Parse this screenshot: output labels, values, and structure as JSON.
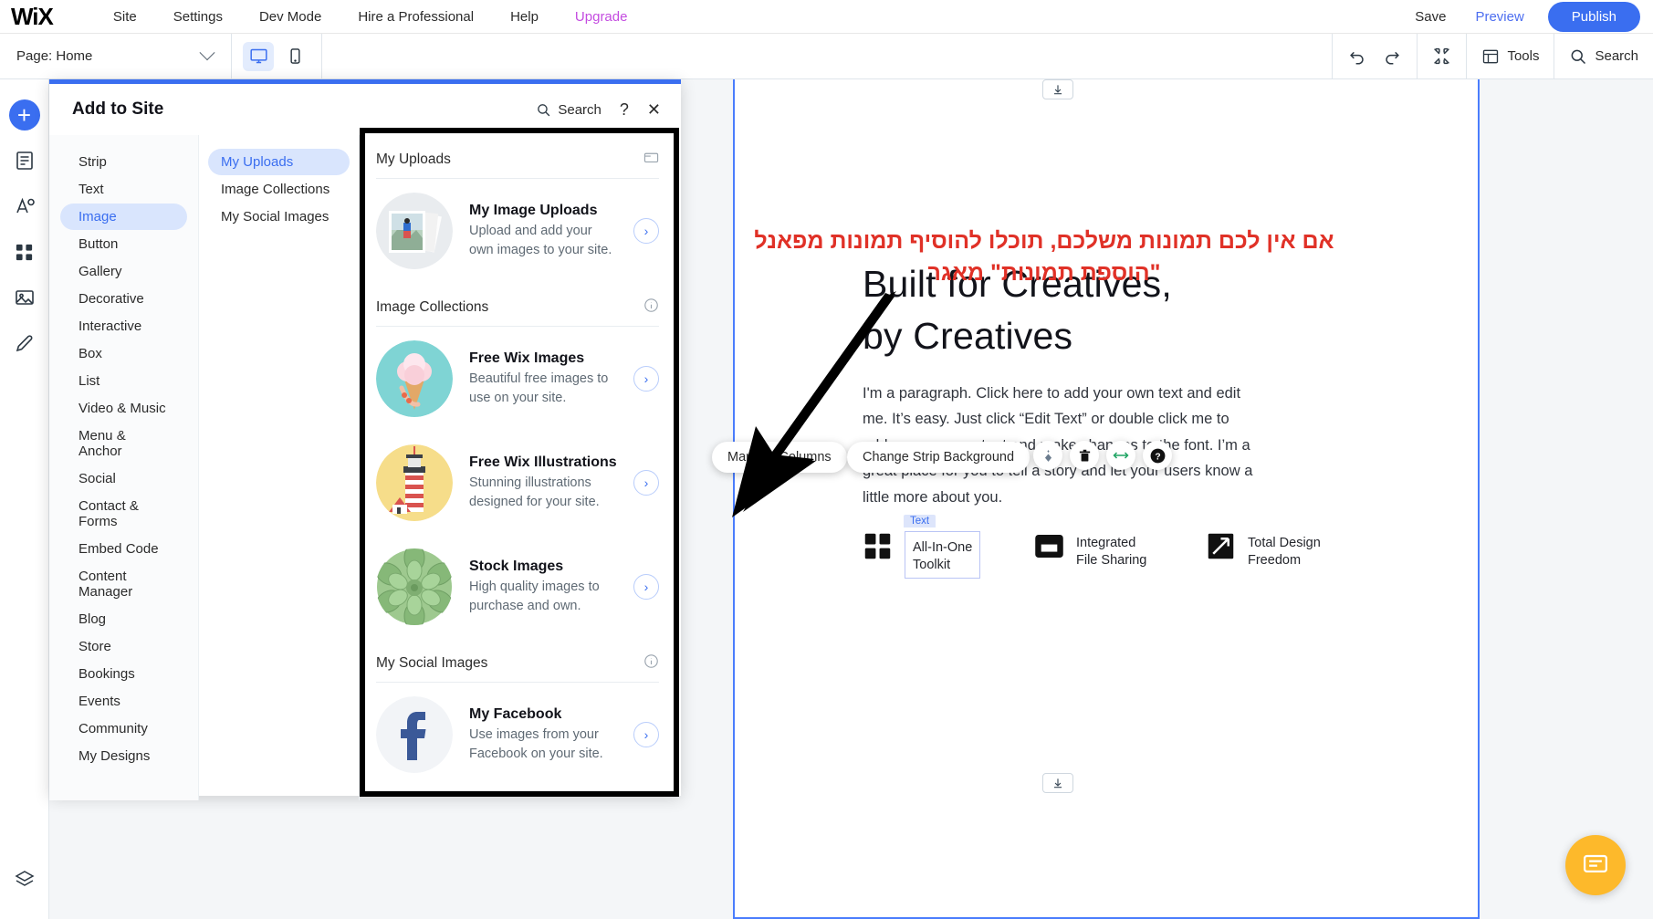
{
  "topbar": {
    "logo": "WiX",
    "menu": [
      {
        "label": "Site"
      },
      {
        "label": "Settings"
      },
      {
        "label": "Dev Mode"
      },
      {
        "label": "Hire a Professional"
      },
      {
        "label": "Help"
      },
      {
        "label": "Upgrade",
        "accent": "#c44ce0"
      }
    ],
    "save_label": "Save",
    "preview_label": "Preview",
    "publish_label": "Publish"
  },
  "secondbar": {
    "page_label": "Page: Home",
    "tools_label": "Tools",
    "search_label": "Search"
  },
  "panel": {
    "title": "Add to Site",
    "search_label": "Search",
    "help_label": "?",
    "close_label": "✕",
    "categories": [
      {
        "label": "Strip"
      },
      {
        "label": "Text"
      },
      {
        "label": "Image",
        "active": true
      },
      {
        "label": "Button"
      },
      {
        "label": "Gallery"
      },
      {
        "label": "Decorative"
      },
      {
        "label": "Interactive"
      },
      {
        "label": "Box"
      },
      {
        "label": "List"
      },
      {
        "label": "Video & Music"
      },
      {
        "label": "Menu & Anchor"
      },
      {
        "label": "Social"
      },
      {
        "label": "Contact & Forms"
      },
      {
        "label": "Embed Code"
      },
      {
        "label": "Content Manager"
      },
      {
        "label": "Blog"
      },
      {
        "label": "Store"
      },
      {
        "label": "Bookings"
      },
      {
        "label": "Events"
      },
      {
        "label": "Community"
      },
      {
        "label": "My Designs"
      }
    ],
    "subcategories": [
      {
        "label": "My Uploads",
        "active": true
      },
      {
        "label": "Image Collections"
      },
      {
        "label": "My Social Images"
      }
    ],
    "sections": [
      {
        "title": "My Uploads",
        "icon": "upload-image-icon",
        "rows": [
          {
            "title": "My Image Uploads",
            "desc": "Upload and add your own images to your site.",
            "thumb": "photos-stack"
          }
        ]
      },
      {
        "title": "Image Collections",
        "icon": "info-icon",
        "rows": [
          {
            "title": "Free Wix Images",
            "desc": "Beautiful free images to use on your site.",
            "thumb": "ice-cream"
          },
          {
            "title": "Free Wix Illustrations",
            "desc": "Stunning illustrations designed for your site.",
            "thumb": "lighthouse"
          },
          {
            "title": "Stock Images",
            "desc": "High quality images to purchase and own.",
            "thumb": "succulent"
          }
        ]
      },
      {
        "title": "My Social Images",
        "icon": "info-icon",
        "rows": [
          {
            "title": "My Facebook",
            "desc": "Use images from your Facebook on your site.",
            "thumb": "facebook"
          }
        ]
      }
    ]
  },
  "canvas": {
    "annotation_hebrew": "אם אין לכם תמונות משלכם, תוכלו להוסיף תמונות מפאנל \"הוספת תמונות\" מאגר",
    "annotation_color": "#e03127",
    "hero_heading_line1": "Built for Creatives,",
    "hero_heading_line2": "by Creatives",
    "hero_paragraph": "I'm a paragraph. Click here to add your own text and edit me. It’s easy. Just click “Edit Text” or double click me to add your own content and make changes to the font. I’m a great place for you to tell a story and let your users know a little more about you.",
    "features": [
      {
        "label_line1": "All-In-One",
        "label_line2": "Toolkit",
        "icon": "grid-icon",
        "selected": true,
        "tag": "Text"
      },
      {
        "label_line1": "Integrated",
        "label_line2": "File Sharing",
        "icon": "window-icon",
        "selected": false
      },
      {
        "label_line1": "Total Design",
        "label_line2": "Freedom",
        "icon": "pen-icon",
        "selected": false
      }
    ],
    "floating_toolbar": {
      "manage_columns": "Manage Columns",
      "change_strip_background": "Change Strip Background"
    }
  }
}
